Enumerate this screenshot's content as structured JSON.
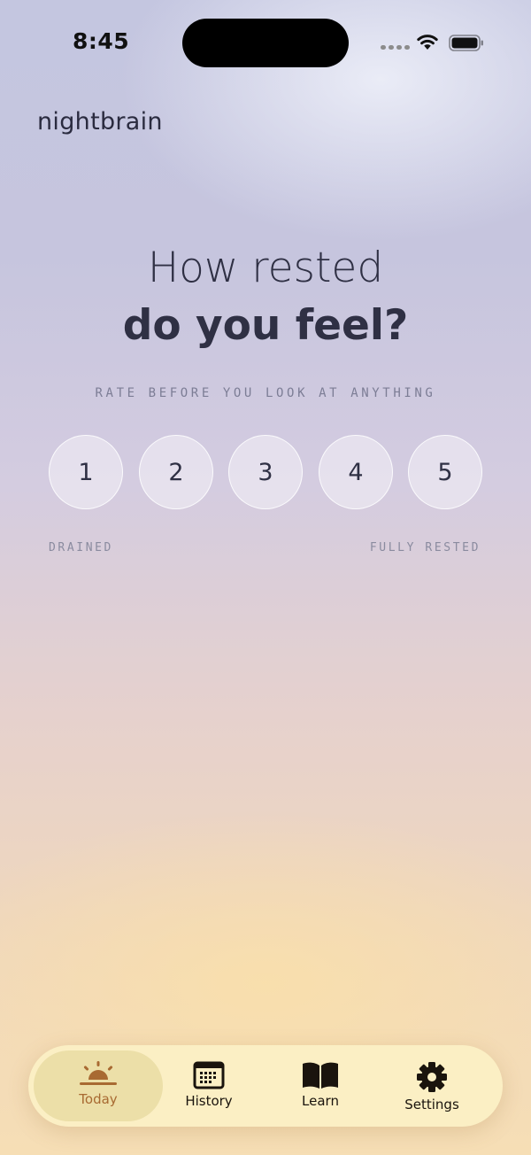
{
  "status_bar": {
    "time": "8:45",
    "icons": [
      "cellular-signal-icon",
      "wifi-icon",
      "battery-icon"
    ]
  },
  "app": {
    "brand": "nightbrain"
  },
  "prompt": {
    "line1": "How rested",
    "line2": "do you feel?",
    "instruction": "RATE BEFORE YOU LOOK AT ANYTHING"
  },
  "rating": {
    "options": [
      "1",
      "2",
      "3",
      "4",
      "5"
    ],
    "low_label": "DRAINED",
    "high_label": "FULLY RESTED"
  },
  "tabs": [
    {
      "label": "Today",
      "icon": "sunrise-icon",
      "active": true
    },
    {
      "label": "History",
      "icon": "calendar-icon",
      "active": false
    },
    {
      "label": "Learn",
      "icon": "book-icon",
      "active": false
    },
    {
      "label": "Settings",
      "icon": "gear-icon",
      "active": false
    }
  ],
  "colors": {
    "accent": "#a86a32",
    "text_dark": "#2f3044",
    "tab_bar_bg": "#fbefc4",
    "tab_active_bg": "#ecdfa8"
  }
}
